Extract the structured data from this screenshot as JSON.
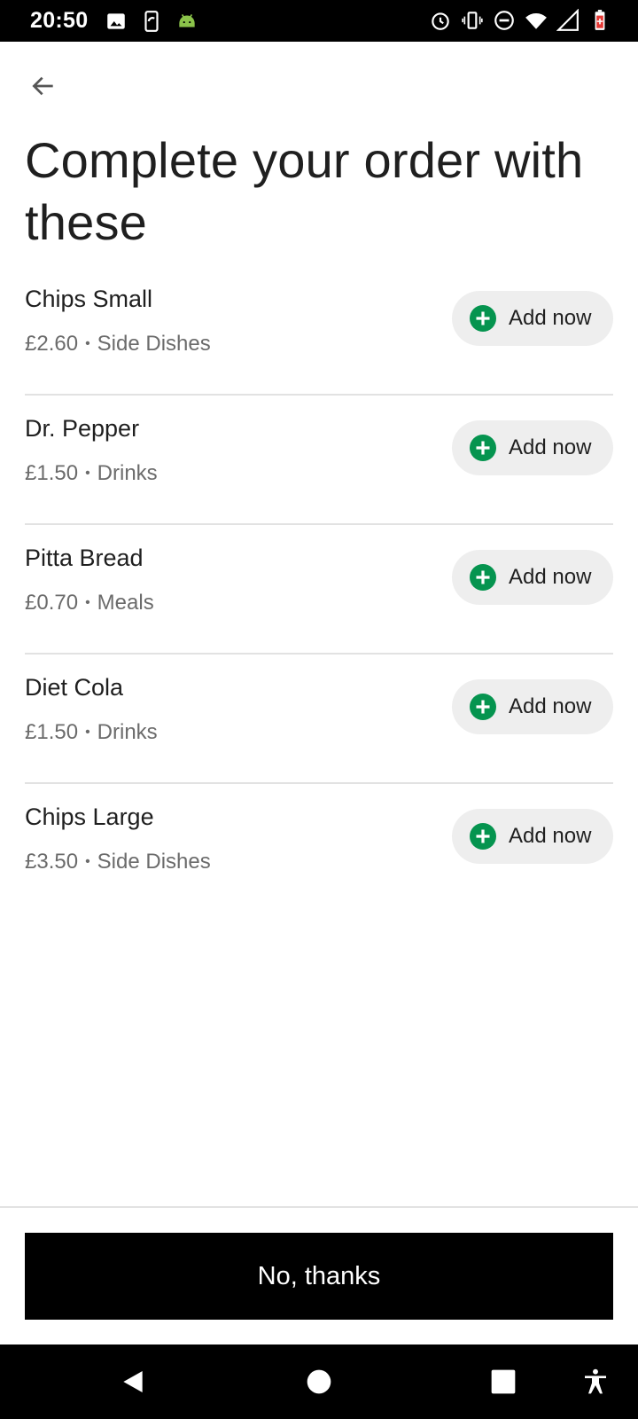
{
  "status_bar": {
    "time": "20:50",
    "left_icons": [
      "image-icon",
      "screen-rotate-icon",
      "android-icon"
    ],
    "right_icons": [
      "alarm-icon",
      "vibrate-icon",
      "dnd-icon",
      "wifi-icon",
      "signal-icon",
      "battery-icon"
    ]
  },
  "header": {
    "back_icon": "arrow-left-icon",
    "title": "Complete your order with these"
  },
  "items": [
    {
      "name": "Chips Small",
      "price": "£2.60",
      "category": "Side Dishes",
      "button_label": "Add now"
    },
    {
      "name": "Dr. Pepper",
      "price": "£1.50",
      "category": "Drinks",
      "button_label": "Add now"
    },
    {
      "name": "Pitta Bread",
      "price": "£0.70",
      "category": "Meals",
      "button_label": "Add now"
    },
    {
      "name": "Diet Cola",
      "price": "£1.50",
      "category": "Drinks",
      "button_label": "Add now"
    },
    {
      "name": "Chips Large",
      "price": "£3.50",
      "category": "Side Dishes",
      "button_label": "Add now"
    }
  ],
  "footer": {
    "decline_label": "No, thanks"
  },
  "nav_bar": {
    "icons": [
      "back-triangle-icon",
      "home-circle-icon",
      "recents-square-icon",
      "accessibility-icon"
    ]
  },
  "colors": {
    "accent_green": "#05944F",
    "button_black": "#000000",
    "pill_gray": "#EEEEEE"
  },
  "separator": "•"
}
